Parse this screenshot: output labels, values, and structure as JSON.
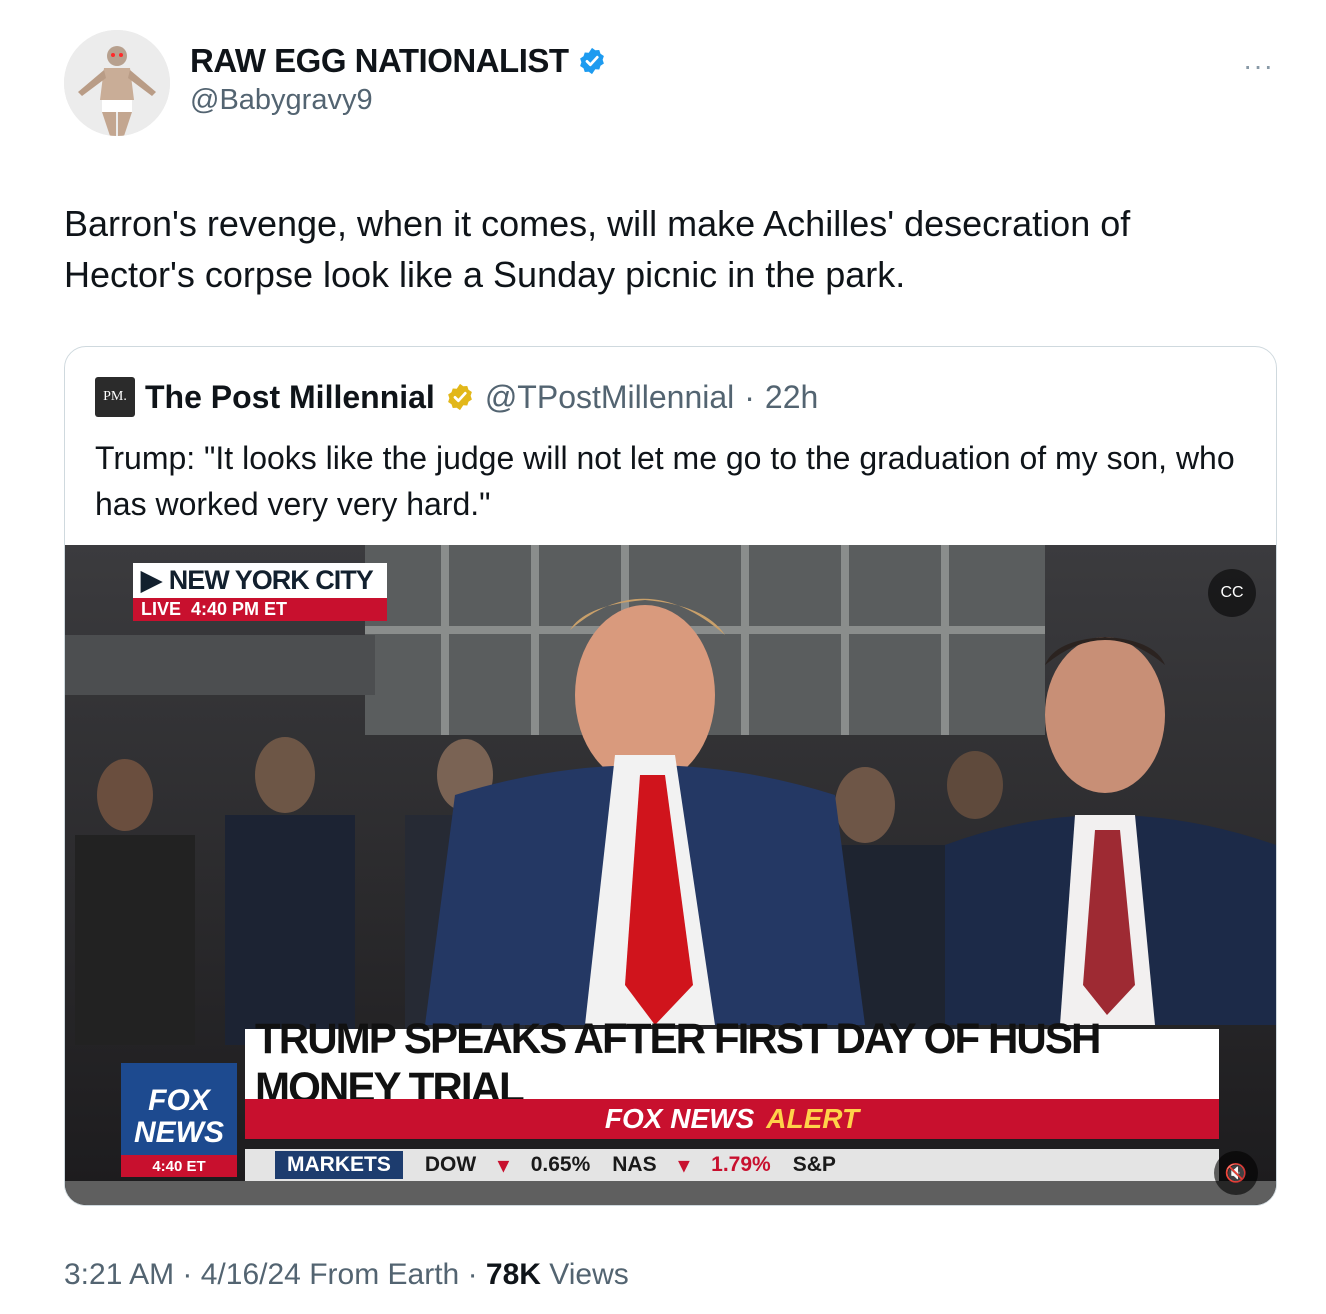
{
  "author": {
    "display_name": "RAW EGG NATIONALIST",
    "handle": "@Babygravy9",
    "verified_badge": "blue-check",
    "more_label": "···"
  },
  "tweet": {
    "text": "Barron's revenge, when it comes, will make Achilles' desecration of Hector's corpse look like a Sunday picnic in the park."
  },
  "quoted": {
    "logo_text": "PM.",
    "name": "The Post Millennial",
    "verified_badge": "gold-check",
    "handle": "@TPostMillennial",
    "separator": "·",
    "age": "22h",
    "text": "Trump: \"It looks like the judge will not let me go to the graduation of my son, who has worked very very hard.\"",
    "video": {
      "location_label": "NEW YORK CITY",
      "live_label": "LIVE",
      "live_time": "4:40 PM ET",
      "headline": "TRUMP SPEAKS AFTER FIRST DAY OF HUSH MONEY TRIAL",
      "alert_brand": "FOX NEWS",
      "alert_word": "ALERT",
      "fox_line1": "FOX",
      "fox_line2": "NEWS",
      "fox_time": "4:40 ET",
      "ticker": {
        "markets": "MARKETS",
        "dow": "DOW",
        "dow_value": "0.65%",
        "nas": "NAS",
        "nas_value": "1.79%",
        "sp": "S&P"
      },
      "captions_label": "CC",
      "mute_label": "🔇"
    }
  },
  "footer": {
    "time": "3:21 AM",
    "date": "4/16/24",
    "source": "From Earth",
    "views_count": "78K",
    "views_label": "Views"
  },
  "colors": {
    "verified_blue": "#1d9bf0",
    "verified_gold": "#e2b719",
    "fox_red": "#c8102e",
    "fox_blue": "#1d4a8f"
  }
}
